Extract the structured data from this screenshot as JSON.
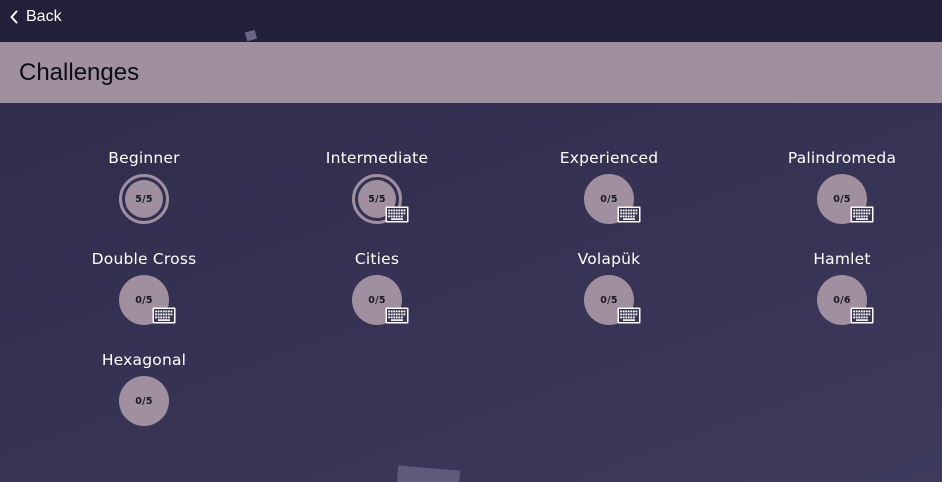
{
  "nav": {
    "back_label": "Back"
  },
  "header": {
    "title": "Challenges"
  },
  "colors": {
    "topbar": "#23203a",
    "header": "#9f8f9f",
    "background": "#35314f",
    "progress_circle": "#9f8f9f"
  },
  "challenges": [
    {
      "name": "Beginner",
      "progress": "5/5",
      "completed": true,
      "keyboard_icon": false
    },
    {
      "name": "Intermediate",
      "progress": "5/5",
      "completed": true,
      "keyboard_icon": true
    },
    {
      "name": "Experienced",
      "progress": "0/5",
      "completed": false,
      "keyboard_icon": true
    },
    {
      "name": "Palindromeda",
      "progress": "0/5",
      "completed": false,
      "keyboard_icon": true
    },
    {
      "name": "Double Cross",
      "progress": "0/5",
      "completed": false,
      "keyboard_icon": true
    },
    {
      "name": "Cities",
      "progress": "0/5",
      "completed": false,
      "keyboard_icon": true
    },
    {
      "name": "Volapük",
      "progress": "0/5",
      "completed": false,
      "keyboard_icon": true
    },
    {
      "name": "Hamlet",
      "progress": "0/6",
      "completed": false,
      "keyboard_icon": true
    },
    {
      "name": "Hexagonal",
      "progress": "0/5",
      "completed": false,
      "keyboard_icon": false
    }
  ]
}
